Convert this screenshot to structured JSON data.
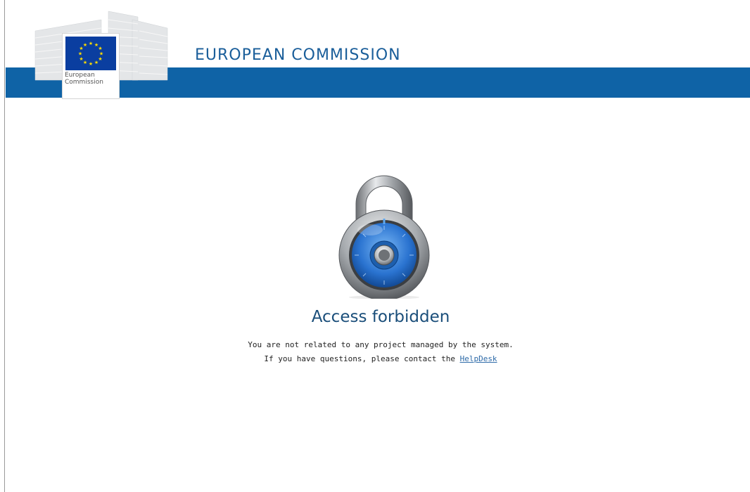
{
  "header": {
    "logo_text_line1": "European",
    "logo_text_line2": "Commission",
    "title": "EUROPEAN COMMISSION"
  },
  "main": {
    "heading": "Access forbidden",
    "message_line1": "You are not related to any project managed by the system.",
    "message_line2_prefix": "If you have questions, please contact the",
    "helpdesk_link": "HelpDesk"
  },
  "colors": {
    "brand_blue": "#0f63a6",
    "title_blue": "#1a5e9a",
    "link_blue": "#2d6aa8",
    "flag_blue": "#0a3ea0",
    "star_yellow": "#ffdd00"
  },
  "icons": {
    "logo": "european-commission-logo",
    "padlock": "combination-padlock-icon"
  }
}
